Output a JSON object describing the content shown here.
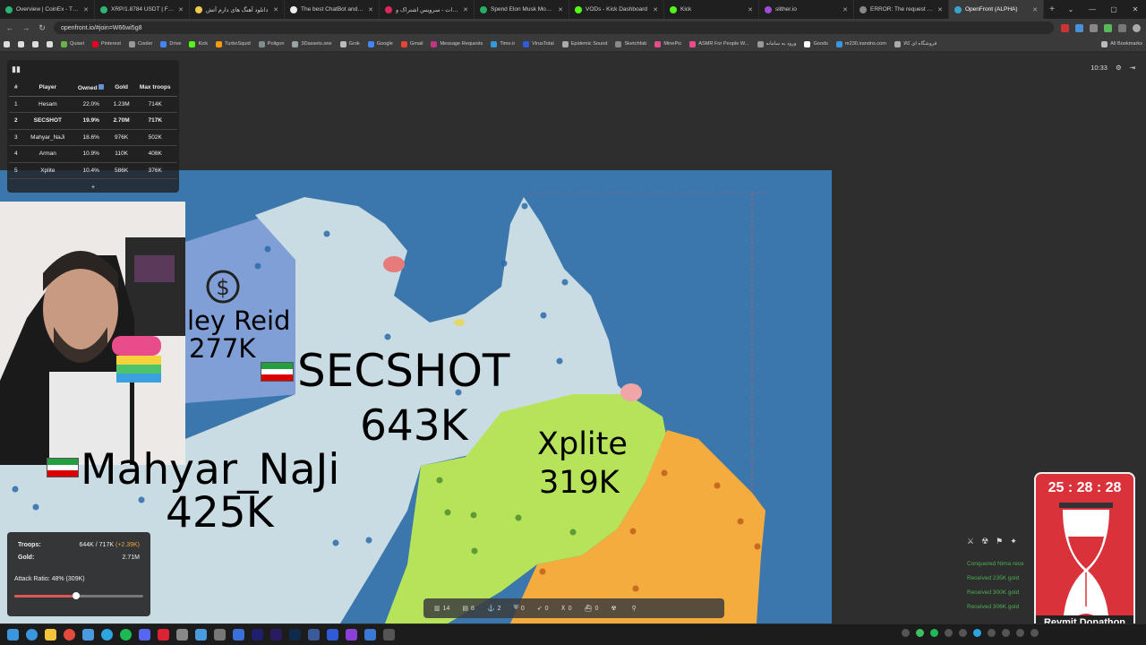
{
  "browser": {
    "tabs": [
      {
        "title": "Overview | CoinEx - The G",
        "color": "#2bb673"
      },
      {
        "title": "XRP/1.8784 USDT | Futur",
        "color": "#2bb673"
      },
      {
        "title": "دانلود آهنگ های دارم آتش",
        "color": "#f2c94c"
      },
      {
        "title": "The best ChatBot and Wr",
        "color": "#eeeeee"
      },
      {
        "title": "آپارات - سرویس اشتراک و",
        "color": "#e0245e"
      },
      {
        "title": "Spend Elon Musk Money",
        "color": "#27ae60"
      },
      {
        "title": "VODs - Kick Dashboard",
        "color": "#53fc18"
      },
      {
        "title": "Kick",
        "color": "#53fc18"
      },
      {
        "title": "slither.io",
        "color": "#a14cd9"
      },
      {
        "title": "ERROR: The request could",
        "color": "#888888"
      },
      {
        "title": "OpenFront (ALPHA)",
        "color": "#3ba3d0"
      }
    ],
    "active_tab_index": 10,
    "url": "openfront.io/#join=W66wi5g8",
    "bookmarks": [
      "Quisel",
      "Pinterest",
      "Cooler",
      "Drive",
      "Kick",
      "TurboSquid",
      "Poligon",
      "3Dassets.one",
      "Grok",
      "Google",
      "Gmail",
      "Message Requests",
      "Time.ir",
      "VirusTotal",
      "Epidemic Sound",
      "Sketchfab",
      "MinePic",
      "ASMR For People W...",
      "ورود به سامانه",
      "Goods",
      "m230.irandns.com",
      "فروشگاه ای کالا"
    ],
    "all_bookmarks_label": "All Bookmarks"
  },
  "leaderboard": {
    "headers": [
      "#",
      "Player",
      "Owned",
      "Gold",
      "Max troops"
    ],
    "rows": [
      {
        "rank": "1",
        "player": "Hesam",
        "owned": "22.0%",
        "gold": "1.23M",
        "max": "714K"
      },
      {
        "rank": "2",
        "player": "SECSHOT",
        "owned": "19.9%",
        "gold": "2.70M",
        "max": "717K"
      },
      {
        "rank": "3",
        "player": "Mahyar_NaJi",
        "owned": "18.6%",
        "gold": "976K",
        "max": "502K"
      },
      {
        "rank": "4",
        "player": "Arman",
        "owned": "10.9%",
        "gold": "110K",
        "max": "408K"
      },
      {
        "rank": "5",
        "player": "Xplite",
        "owned": "10.4%",
        "gold": "586K",
        "max": "376K"
      }
    ],
    "more": "+"
  },
  "game_time": "10:33",
  "map_labels": {
    "reid_name": "ley Reid",
    "reid_troops": "277K",
    "secshot_name": "SECSHOT",
    "secshot_troops": "643K",
    "xplite_name": "Xplite",
    "xplite_troops": "319K",
    "mahyar_name": "Mahyar_NaJi",
    "mahyar_troops": "425K"
  },
  "stats": {
    "troops_label": "Troops:",
    "troops_value": "644K / 717K",
    "troops_delta": "(+2.39K)",
    "gold_label": "Gold:",
    "gold_value": "2.71M",
    "attack_ratio": "Attack Ratio: 48% (309K)",
    "attack_ratio_fraction": 0.48
  },
  "build_bar": [
    {
      "icon": "city-icon",
      "count": "14"
    },
    {
      "icon": "factory-icon",
      "count": "8"
    },
    {
      "icon": "port-icon",
      "count": "2"
    },
    {
      "icon": "defense-post-icon",
      "count": "0"
    },
    {
      "icon": "missile-silo-icon",
      "count": "0"
    },
    {
      "icon": "sam-launcher-icon",
      "count": "0"
    },
    {
      "icon": "warship-icon",
      "count": "0"
    },
    {
      "icon": "nuke-icon",
      "count": ""
    },
    {
      "icon": "mirv-icon",
      "count": ""
    }
  ],
  "feed": [
    "Conquered Nima rece",
    "Received 235K gold",
    "Received 300K gold",
    "Received 306K gold"
  ],
  "timer": {
    "time": "25 : 28 : 28",
    "label": "Reymit Donathon"
  },
  "colors": {
    "ocean": "#3b77ad",
    "secshot_land": "#c9dbe3",
    "xplite_land": "#b6e35a",
    "orange_land": "#f3ac3d",
    "reid_land": "#7f9fd6",
    "timer_red": "#d9323a",
    "feed_green": "#4caf50"
  }
}
